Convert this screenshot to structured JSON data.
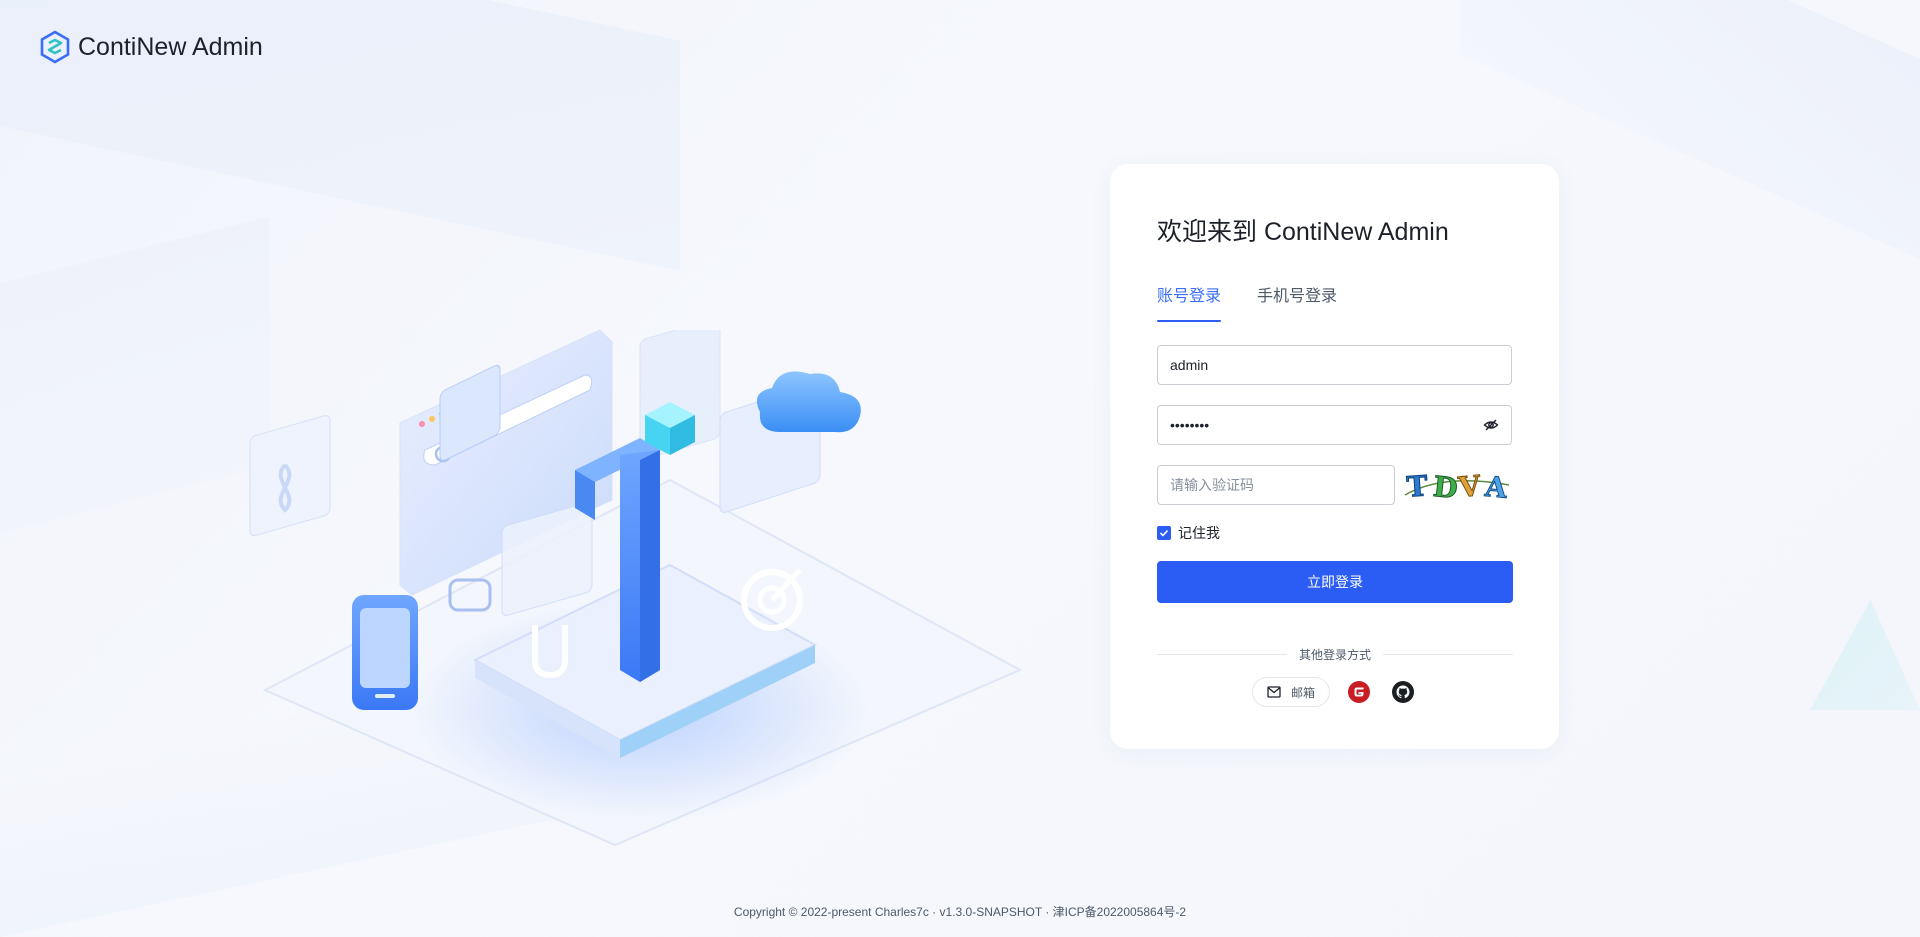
{
  "header": {
    "app_name": "ContiNew Admin"
  },
  "login": {
    "title": "欢迎来到 ContiNew Admin",
    "tabs": [
      {
        "label": "账号登录",
        "active": true
      },
      {
        "label": "手机号登录",
        "active": false
      }
    ],
    "username": {
      "value": "admin",
      "placeholder": ""
    },
    "password": {
      "value": "12345678",
      "placeholder": ""
    },
    "captcha": {
      "value": "",
      "placeholder": "请输入验证码",
      "image_text": "TDVA"
    },
    "remember_label": "记住我",
    "remember_checked": true,
    "submit_label": "立即登录",
    "other_methods_label": "其他登录方式",
    "email_label": "邮箱"
  },
  "footer": {
    "text": "Copyright © 2022-present Charles7c · v1.3.0-SNAPSHOT · 津ICP备2022005864号-2"
  },
  "colors": {
    "primary": "#2b5cf4",
    "gitee": "#c71d23",
    "github": "#1b1f23"
  }
}
